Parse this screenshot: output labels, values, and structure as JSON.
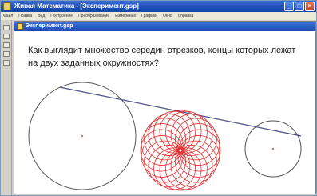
{
  "app": {
    "title": "Живая Математика - [Эксперимент.gsp]",
    "window_controls": [
      "_",
      "□",
      "×"
    ]
  },
  "menu": {
    "items": [
      "Файл",
      "Правка",
      "Вид",
      "Построение",
      "Преобразование",
      "Измерение",
      "Графики",
      "Окно",
      "Справка"
    ]
  },
  "document": {
    "title": "Эксперимент.gsp",
    "question": "Как выглядит множество середин отрезков, концы которых лежат на двух заданных окружностях?"
  },
  "colors": {
    "circle_stroke": "#555555",
    "segment_stroke": "#4a4e8a",
    "locus_stroke": "#e03030",
    "center_point": "#d07070"
  }
}
